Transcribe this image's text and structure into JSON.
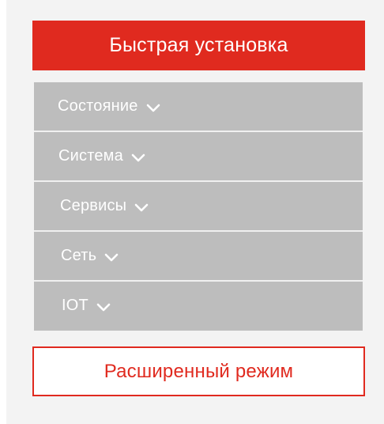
{
  "quick_setup": {
    "label": "Быстрая установка"
  },
  "menu": {
    "items": [
      {
        "label": "Состояние",
        "icon": "chevron-down-icon"
      },
      {
        "label": "Система",
        "icon": "chevron-down-icon"
      },
      {
        "label": "Сервисы",
        "icon": "chevron-down-icon"
      },
      {
        "label": "Сеть",
        "icon": "chevron-down-icon"
      },
      {
        "label": "IOT",
        "icon": "chevron-down-icon"
      }
    ]
  },
  "advanced_mode": {
    "label": "Расширенный режим"
  },
  "colors": {
    "accent": "#e02a1f",
    "menu_bg": "#bdbdbd",
    "panel_bg": "#f3f3f3",
    "text_on_accent": "#ffffff"
  }
}
